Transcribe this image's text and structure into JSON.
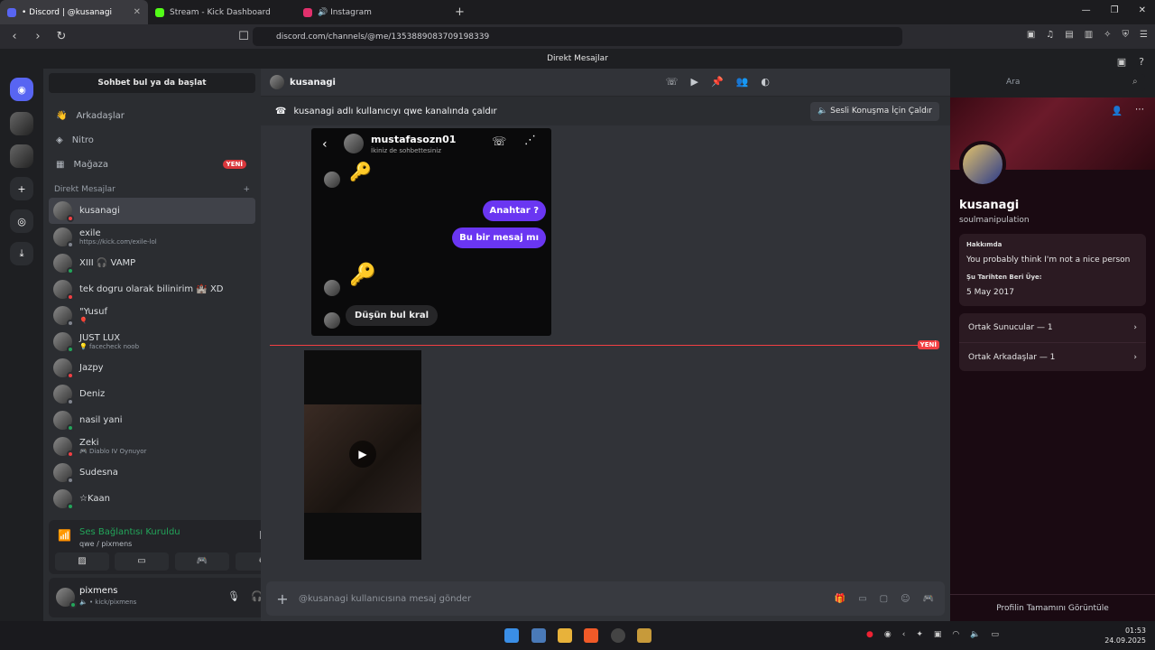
{
  "browser": {
    "tabs": [
      {
        "label": "• Discord | @kusanagi",
        "color": "#5865f2"
      },
      {
        "label": "Stream - Kick Dashboard",
        "color": "#53fc18"
      },
      {
        "label": "🔊 Instagram",
        "color": "#e1306c"
      }
    ],
    "url": "discord.com/channels/@me/1353889083709198339"
  },
  "app": {
    "title": "Direkt Mesajlar"
  },
  "sidebar": {
    "search": "Sohbet bul ya da başlat",
    "nav": [
      {
        "label": "Arkadaşlar",
        "icon": "friends-icon"
      },
      {
        "label": "Nitro",
        "icon": "nitro-icon"
      },
      {
        "label": "Mağaza",
        "icon": "shop-icon",
        "badge": "YENİ"
      }
    ],
    "dm_header": "Direkt Mesajlar",
    "dms": [
      {
        "name": "kusanagi",
        "status": "",
        "selected": true
      },
      {
        "name": "exile",
        "status": "https://kick.com/exile-lol"
      },
      {
        "name": "XIII 🎧 VAMP",
        "status": ""
      },
      {
        "name": "tek dogru olarak bilinirim 🏰 XD",
        "status": ""
      },
      {
        "name": "\"Yusuf",
        "status": "🎈"
      },
      {
        "name": "JUST LUX",
        "status": "💡 facecheck noob"
      },
      {
        "name": "Jazpy",
        "status": ""
      },
      {
        "name": "Deniz",
        "status": ""
      },
      {
        "name": "nasil yani",
        "status": ""
      },
      {
        "name": "Zeki",
        "status": "🎮 Diablo IV Oynuyor"
      },
      {
        "name": "Sudesna",
        "status": ""
      },
      {
        "name": "☆Kaan",
        "status": ""
      }
    ],
    "voice": {
      "title": "Ses Bağlantısı Kuruldu",
      "channel": "qwe / pixmens"
    },
    "user": {
      "name": "pixmens",
      "status": "🔈 • kick/pixmens"
    }
  },
  "chat": {
    "name": "kusanagi",
    "search_placeholder": "Ara",
    "call_text": "kusanagi adlı kullanıcıyı qwe kanalında çaldır",
    "call_button": "Sesli Konuşma İçin Çaldır",
    "shot": {
      "contact": "mustafasozn01",
      "sub": "İkiniz de sohbettesiniz",
      "msg1": "Anahtar ?",
      "msg2": "Bu bir mesaj mı",
      "msg3": "Düşün bul kral"
    },
    "new_label": "YENİ",
    "composer_placeholder": "@kusanagi kullanıcısına mesaj gönder"
  },
  "profile": {
    "name": "kusanagi",
    "username": "soulmanipulation",
    "about_title": "Hakkımda",
    "about": "You probably think I'm not a nice person",
    "since_title": "Şu Tarihten Beri Üye:",
    "since": "5 May 2017",
    "servers": "Ortak Sunucular — 1",
    "friends": "Ortak Arkadaşlar — 1",
    "view_full": "Profilin Tamamını Görüntüle"
  },
  "taskbar": {
    "time": "01:53",
    "date": "24.09.2025"
  }
}
